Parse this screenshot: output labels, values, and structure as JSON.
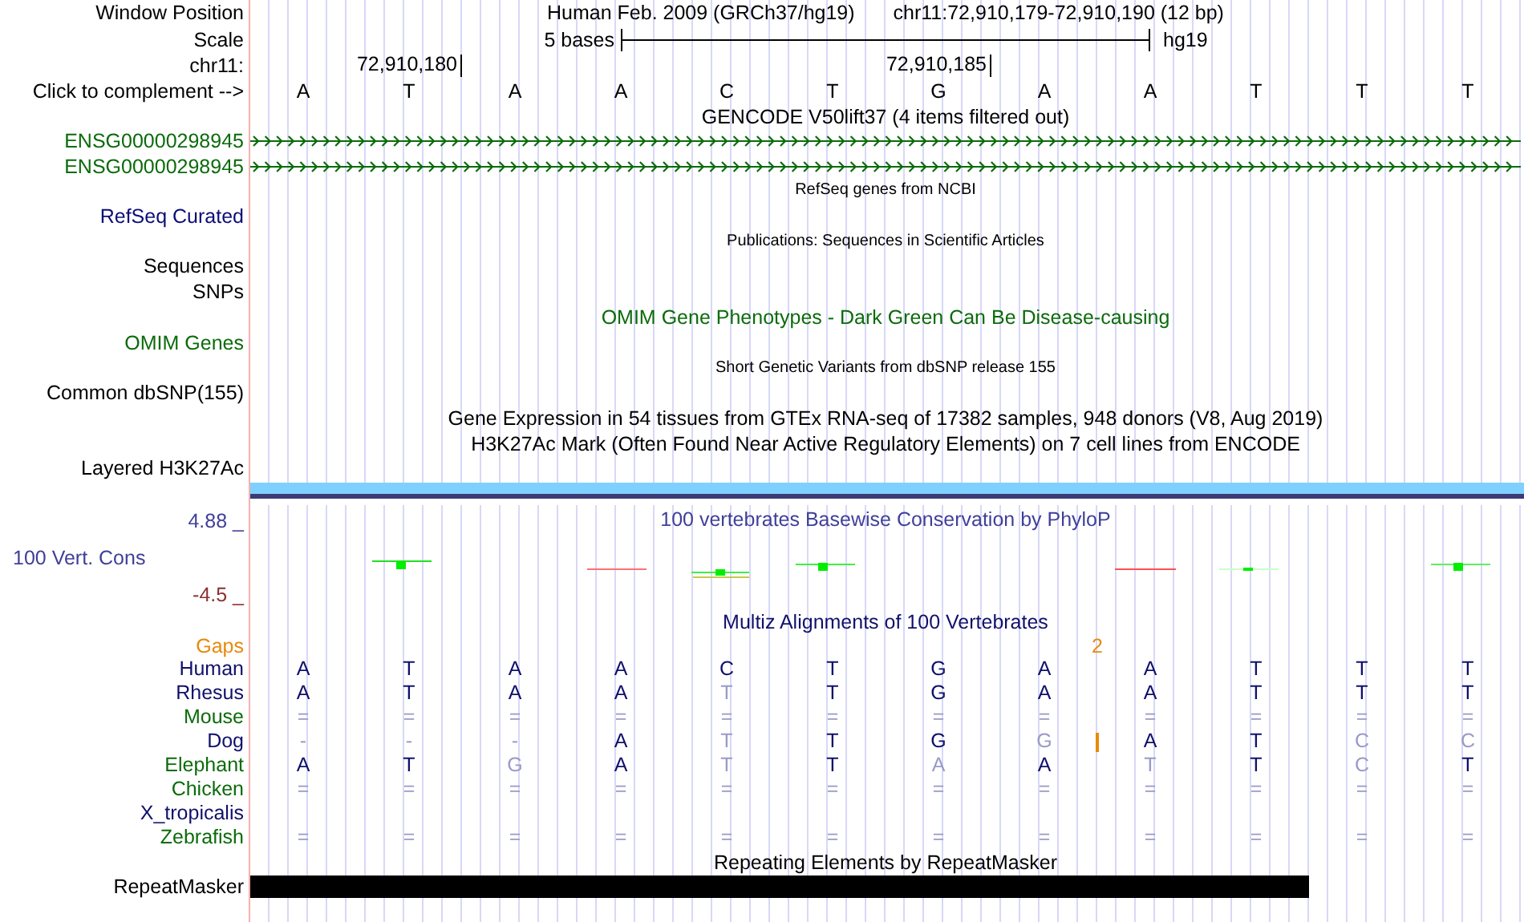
{
  "header": {
    "label": "Window Position",
    "assembly": "Human Feb. 2009 (GRCh37/hg19)",
    "range": "chr11:72,910,179-72,910,190 (12 bp)"
  },
  "scale": {
    "label": "Scale",
    "length": "5 bases",
    "assembly": "hg19"
  },
  "ruler": {
    "label": "chr11:",
    "ticks": [
      "72,910,180",
      "72,910,185"
    ]
  },
  "bases": {
    "label": "Click to complement -->",
    "letters": [
      "A",
      "T",
      "A",
      "A",
      "C",
      "T",
      "G",
      "A",
      "A",
      "T",
      "T",
      "T"
    ]
  },
  "tracks": [
    {
      "kind": "title",
      "text": "GENCODE V50lift37 (4 items filtered out)",
      "color": "#000000"
    },
    {
      "kind": "gene",
      "label": "ENSG00000298945",
      "color": "#0b6b0b"
    },
    {
      "kind": "gene",
      "label": "ENSG00000298945",
      "color": "#0b6b0b"
    },
    {
      "kind": "note",
      "text": "RefSeq genes from NCBI"
    },
    {
      "kind": "label",
      "label": "RefSeq Curated",
      "color": "#0c0c78"
    },
    {
      "kind": "note",
      "text": "Publications: Sequences in Scientific Articles"
    },
    {
      "kind": "label",
      "label": "Sequences",
      "color": "#000000"
    },
    {
      "kind": "label",
      "label": "SNPs",
      "color": "#000000"
    },
    {
      "kind": "title",
      "text": "OMIM Gene Phenotypes - Dark Green Can Be Disease-causing",
      "color": "#0b6b0b"
    },
    {
      "kind": "label",
      "label": "OMIM Genes",
      "color": "#0b6b0b"
    },
    {
      "kind": "note",
      "text": "Short Genetic Variants from dbSNP release 155"
    },
    {
      "kind": "label",
      "label": "Common dbSNP(155)",
      "color": "#000000"
    },
    {
      "kind": "title",
      "text": "Gene Expression in 54 tissues from GTEx RNA-seq of 17382 samples, 948 donors (V8, Aug 2019)",
      "color": "#000000"
    },
    {
      "kind": "title",
      "text": "H3K27Ac Mark (Often Found Near Active Regulatory Elements) on 7 cell lines from ENCODE",
      "color": "#000000"
    },
    {
      "kind": "label",
      "label": "Layered H3K27Ac",
      "color": "#000000"
    },
    {
      "kind": "bar",
      "color": "#80d0ff"
    },
    {
      "kind": "conservation",
      "title": "100 vertebrates Basewise Conservation by PhyloP",
      "label": "100 Vert. Cons",
      "max": "4.88 _",
      "min": "-4.5 _",
      "color": "#40409a"
    },
    {
      "kind": "title",
      "text": "Multiz Alignments of 100 Vertebrates",
      "color": "#10106b"
    },
    {
      "kind": "gaps",
      "label": "Gaps",
      "count": "2",
      "color": "#e8890c"
    },
    {
      "kind": "species",
      "label": "Human",
      "color": "#10106b",
      "insertion": false,
      "bases": [
        {
          "b": "A",
          "faded": false
        },
        {
          "b": "T",
          "faded": false
        },
        {
          "b": "A",
          "faded": false
        },
        {
          "b": "A",
          "faded": false
        },
        {
          "b": "C",
          "faded": false
        },
        {
          "b": "T",
          "faded": false
        },
        {
          "b": "G",
          "faded": false
        },
        {
          "b": "A",
          "faded": false
        },
        {
          "b": "A",
          "faded": false
        },
        {
          "b": "T",
          "faded": false
        },
        {
          "b": "T",
          "faded": false
        },
        {
          "b": "T",
          "faded": false
        }
      ]
    },
    {
      "kind": "species",
      "label": "Rhesus",
      "color": "#10106b",
      "insertion": false,
      "bases": [
        {
          "b": "A",
          "faded": false
        },
        {
          "b": "T",
          "faded": false
        },
        {
          "b": "A",
          "faded": false
        },
        {
          "b": "A",
          "faded": false
        },
        {
          "b": "T",
          "faded": true
        },
        {
          "b": "T",
          "faded": false
        },
        {
          "b": "G",
          "faded": false
        },
        {
          "b": "A",
          "faded": false
        },
        {
          "b": "A",
          "faded": false
        },
        {
          "b": "T",
          "faded": false
        },
        {
          "b": "T",
          "faded": false
        },
        {
          "b": "T",
          "faded": false
        }
      ]
    },
    {
      "kind": "species",
      "label": "Mouse",
      "color": "#0b6b0b",
      "insertion": false,
      "bases": [
        {
          "b": "=",
          "faded": true
        },
        {
          "b": "=",
          "faded": true
        },
        {
          "b": "=",
          "faded": true
        },
        {
          "b": "=",
          "faded": true
        },
        {
          "b": "=",
          "faded": true
        },
        {
          "b": "=",
          "faded": true
        },
        {
          "b": "=",
          "faded": true
        },
        {
          "b": "=",
          "faded": true
        },
        {
          "b": "=",
          "faded": true
        },
        {
          "b": "=",
          "faded": true
        },
        {
          "b": "=",
          "faded": true
        },
        {
          "b": "=",
          "faded": true
        }
      ]
    },
    {
      "kind": "species",
      "label": "Dog",
      "color": "#10106b",
      "insertion": true,
      "bases": [
        {
          "b": "-",
          "faded": true
        },
        {
          "b": "-",
          "faded": true
        },
        {
          "b": "-",
          "faded": true
        },
        {
          "b": "A",
          "faded": false
        },
        {
          "b": "T",
          "faded": true
        },
        {
          "b": "T",
          "faded": false
        },
        {
          "b": "G",
          "faded": false
        },
        {
          "b": "G",
          "faded": true
        },
        {
          "b": "A",
          "faded": false
        },
        {
          "b": "T",
          "faded": false
        },
        {
          "b": "C",
          "faded": true
        },
        {
          "b": "C",
          "faded": true
        }
      ]
    },
    {
      "kind": "species",
      "label": "Elephant",
      "color": "#0b6b0b",
      "insertion": false,
      "bases": [
        {
          "b": "A",
          "faded": false
        },
        {
          "b": "T",
          "faded": false
        },
        {
          "b": "G",
          "faded": true
        },
        {
          "b": "A",
          "faded": false
        },
        {
          "b": "T",
          "faded": true
        },
        {
          "b": "T",
          "faded": false
        },
        {
          "b": "A",
          "faded": true
        },
        {
          "b": "A",
          "faded": false
        },
        {
          "b": "T",
          "faded": true
        },
        {
          "b": "T",
          "faded": false
        },
        {
          "b": "C",
          "faded": true
        },
        {
          "b": "T",
          "faded": false
        }
      ]
    },
    {
      "kind": "species",
      "label": "Chicken",
      "color": "#0b6b0b",
      "insertion": false,
      "bases": [
        {
          "b": "=",
          "faded": true
        },
        {
          "b": "=",
          "faded": true
        },
        {
          "b": "=",
          "faded": true
        },
        {
          "b": "=",
          "faded": true
        },
        {
          "b": "=",
          "faded": true
        },
        {
          "b": "=",
          "faded": true
        },
        {
          "b": "=",
          "faded": true
        },
        {
          "b": "=",
          "faded": true
        },
        {
          "b": "=",
          "faded": true
        },
        {
          "b": "=",
          "faded": true
        },
        {
          "b": "=",
          "faded": true
        },
        {
          "b": "=",
          "faded": true
        }
      ]
    },
    {
      "kind": "species",
      "label": "X_tropicalis",
      "color": "#10106b",
      "insertion": false
    },
    {
      "kind": "species",
      "label": "Zebrafish",
      "color": "#0b6b0b",
      "insertion": false,
      "bases": [
        {
          "b": "=",
          "faded": true
        },
        {
          "b": "=",
          "faded": true
        },
        {
          "b": "=",
          "faded": true
        },
        {
          "b": "=",
          "faded": true
        },
        {
          "b": "=",
          "faded": true
        },
        {
          "b": "=",
          "faded": true
        },
        {
          "b": "=",
          "faded": true
        },
        {
          "b": "=",
          "faded": true
        },
        {
          "b": "=",
          "faded": true
        },
        {
          "b": "=",
          "faded": true
        },
        {
          "b": "=",
          "faded": true
        },
        {
          "b": "=",
          "faded": true
        }
      ]
    },
    {
      "kind": "title",
      "text": "Repeating Elements by RepeatMasker",
      "color": "#000000"
    },
    {
      "kind": "repeat",
      "label": "RepeatMasker"
    }
  ]
}
